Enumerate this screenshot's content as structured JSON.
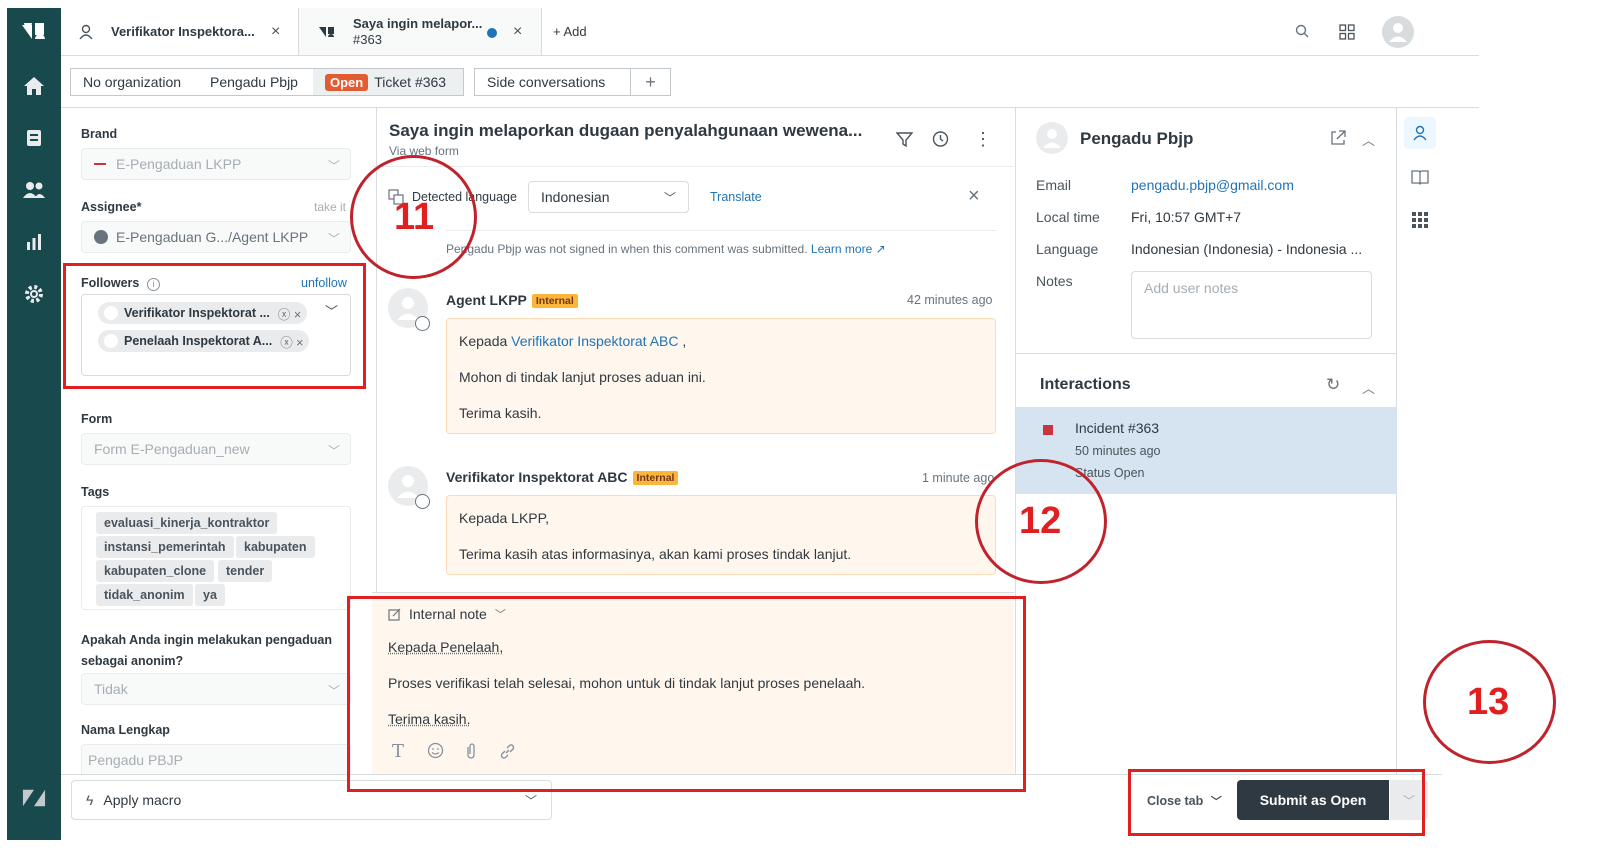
{
  "tabs": [
    {
      "label": "Verifikator Inspektora...",
      "close": "×"
    },
    {
      "label": "Saya ingin melapor...",
      "sub": "#363",
      "close": "×"
    },
    {
      "label": "+ Add"
    }
  ],
  "ticketbar": {
    "org": "No organization",
    "requester": "Pengadu Pbjp",
    "status_badge": "Open",
    "ticket": "Ticket #363",
    "side_conv": "Side conversations",
    "plus": "+"
  },
  "left": {
    "brand_label": "Brand",
    "brand_value": "E-Pengaduan LKPP",
    "assignee_label": "Assignee*",
    "take_it": "take it",
    "assignee_value": "E-Pengaduan G.../Agent LKPP",
    "followers_label": "Followers",
    "unfollow": "unfollow",
    "followers": [
      "Verifikator Inspektorat ...",
      "Penelaah Inspektorat A..."
    ],
    "form_label": "Form",
    "form_value": "Form E-Pengaduan_new",
    "tags_label": "Tags",
    "tags": [
      "evaluasi_kinerja_kontraktor",
      "instansi_pemerintah",
      "kabupaten",
      "kabupaten_clone",
      "tender",
      "tidak_anonim",
      "ya"
    ],
    "anon_label_1": "Apakah Anda ingin melakukan pengaduan",
    "anon_label_2": "sebagai anonim?",
    "anon_value": "Tidak",
    "name_label": "Nama Lengkap",
    "name_value": "Pengadu PBJP"
  },
  "conversation": {
    "subject": "Saya ingin melaporkan dugaan penyalahgunaan wewena...",
    "via": "Via web form",
    "detected_language": "Detected language",
    "language_value": "Indonesian",
    "translate": "Translate",
    "notice": "Pengadu Pbjp was not signed in when this comment was submitted.",
    "learn_more": "Learn more",
    "messages": [
      {
        "author": "Agent LKPP",
        "badge": "Internal",
        "time": "42 minutes ago",
        "line1_pre": "Kepada ",
        "line1_link": "Verifikator Inspektorat ABC",
        "line1_post": " ,",
        "line2": "Mohon di tindak lanjut proses aduan ini.",
        "line3": "Terima kasih."
      },
      {
        "author": "Verifikator Inspektorat ABC",
        "badge": "Internal",
        "time": "1 minute ago",
        "line1": "Kepada LKPP,",
        "line2": "Terima kasih atas informasinya, akan kami proses tindak lanjut."
      }
    ],
    "composer": {
      "mode": "Internal note",
      "line1": "Kepada Penelaah,",
      "line2": "Proses verifikasi telah selesai, mohon untuk di tindak lanjut proses penelaah.",
      "line3": "Terima kasih."
    }
  },
  "user": {
    "name": "Pengadu Pbjp",
    "email_label": "Email",
    "email": "pengadu.pbjp@gmail.com",
    "localtime_label": "Local time",
    "localtime": "Fri, 10:57 GMT+7",
    "language_label": "Language",
    "language": "Indonesian (Indonesia) - Indonesia ...",
    "notes_label": "Notes",
    "notes_placeholder": "Add user notes"
  },
  "interactions": {
    "title": "Interactions",
    "item_title": "Incident #363",
    "item_time": "50 minutes ago",
    "item_status": "Status Open"
  },
  "bottom": {
    "apply_macro": "Apply macro",
    "close_tab": "Close tab",
    "submit": "Submit as Open"
  },
  "annotations": {
    "n11": "11",
    "n12": "12",
    "n13": "13"
  },
  "colors": {
    "nav": "#17494d",
    "accent_red": "#e02020",
    "internal_bg": "#fff7ed",
    "submit_bg": "#2f3941",
    "open_badge": "#e35b33"
  }
}
